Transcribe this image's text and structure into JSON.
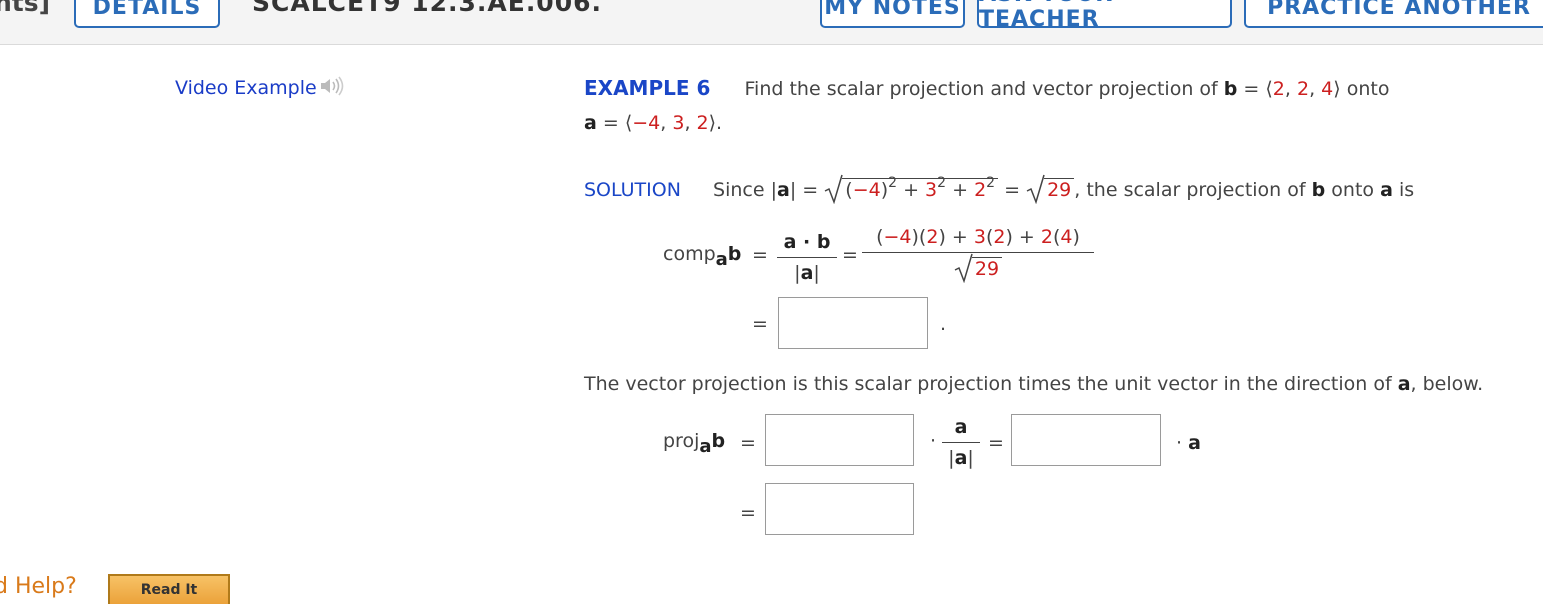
{
  "header": {
    "points": "nts]",
    "details": "DETAILS",
    "question_id": "SCALCET9 12.3.AE.006.",
    "my_notes": "MY NOTES",
    "ask_teacher": "ASK YOUR TEACHER",
    "practice_another": "PRACTICE ANOTHER"
  },
  "video_example": "Video Example",
  "example": {
    "label": "EXAMPLE 6",
    "text1": "Find the scalar projection and vector projection of",
    "b_sym": "b",
    "eq": " = ",
    "b_open": "⟨",
    "b_v1": "2",
    "b_v2": "2",
    "b_v3": "4",
    "b_close": "⟩",
    "onto": "onto",
    "a_sym": "a",
    "a_open": "⟨",
    "a_v1": "−4",
    "a_v2": "3",
    "a_v3": "2",
    "a_close": "⟩."
  },
  "solution": {
    "label": "SOLUTION",
    "since": "Since |",
    "a_sym": "a",
    "abs_close": "| =",
    "rad_open": "(",
    "rad_m4": "−4",
    "rad_close": ")",
    "exp2": "2",
    "plus1": " + ",
    "rad_3": "3",
    "plus2": " + ",
    "rad_2": "2",
    "eq2": " = ",
    "rad29": "29",
    "tail": ", the scalar projection of",
    "b_sym": "b",
    "onto": "onto",
    "a_sym2": "a",
    "is": "is"
  },
  "comp": {
    "label": "comp",
    "sub": "a",
    "b_sym": "b",
    "eq": "=",
    "frac1_num": "a · b",
    "frac1_den": "|a|",
    "eq2": "=",
    "num_p1": "(",
    "num_m4": "−4",
    "num_p2": ")(",
    "num_2a": "2",
    "num_p3": ") + ",
    "num_3": "3",
    "num_p4": "(",
    "num_2b": "2",
    "num_p5": ") + ",
    "num_2c": "2",
    "num_p6": "(",
    "num_4": "4",
    "num_p7": ")",
    "den29": "29",
    "eq3": "=",
    "period": "."
  },
  "vector_text": {
    "part1": "The vector projection is this scalar projection times the unit vector in the direction of",
    "a_sym": "a",
    "part2": ", below."
  },
  "proj": {
    "label": "proj",
    "sub": "a",
    "b_sym": "b",
    "eq": "=",
    "dot": "·",
    "frac_num": "a",
    "frac_den": "|a|",
    "eq2": "=",
    "dot2": "·",
    "a_sym": "a",
    "eq3": "="
  },
  "footer": {
    "need_help": "d Help?",
    "read_it": "Read It"
  }
}
